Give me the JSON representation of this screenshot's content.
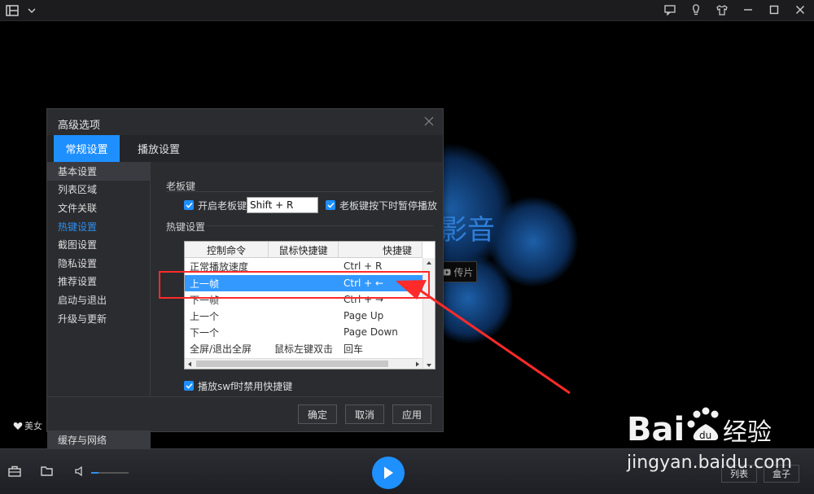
{
  "titlebar": {
    "icons": [
      "playlist-icon",
      "chevron-down-icon",
      "message-icon",
      "bulb-icon",
      "shirt-icon",
      "minimize-icon",
      "maximize-icon",
      "close-icon"
    ]
  },
  "stage": {
    "brand_text": "影音",
    "upload_label": "传片",
    "meinv_label": "美女"
  },
  "dialog": {
    "title": "高级选项",
    "tabs": [
      {
        "label": "常规设置",
        "active": true
      },
      {
        "label": "播放设置",
        "active": false
      }
    ],
    "sidebar": {
      "items": [
        {
          "label": "基本设置"
        },
        {
          "label": "列表区域"
        },
        {
          "label": "文件关联"
        },
        {
          "label": "热键设置"
        },
        {
          "label": "截图设置"
        },
        {
          "label": "隐私设置"
        },
        {
          "label": "推荐设置"
        },
        {
          "label": "启动与退出"
        },
        {
          "label": "升级与更新"
        }
      ],
      "bottom_item": "缓存与网络"
    },
    "boss_key": {
      "section": "老板键",
      "enable_label": "开启老板键",
      "key_value": "Shift + R",
      "pause_label": "老板键按下时暂停播放"
    },
    "hotkeys": {
      "section": "热键设置",
      "columns": [
        "控制命令",
        "鼠标快捷键",
        "快捷键"
      ],
      "rows": [
        {
          "command": "正常播放速度",
          "mouse": "",
          "key": "Ctrl + R"
        },
        {
          "command": "上一帧",
          "mouse": "",
          "key": "Ctrl + ←"
        },
        {
          "command": "下一帧",
          "mouse": "",
          "key": "Ctrl + →"
        },
        {
          "command": "上一个",
          "mouse": "",
          "key": "Page Up"
        },
        {
          "command": "下一个",
          "mouse": "",
          "key": "Page Down"
        },
        {
          "command": "全屏/退出全屏",
          "mouse": "鼠标左键双击",
          "key": "回车"
        }
      ],
      "swf_label": "播放swf时禁用快捷键"
    },
    "buttons": {
      "ok": "确定",
      "cancel": "取消",
      "apply": "应用"
    }
  },
  "bottombar": {
    "volume_level": 0.2,
    "list_label": "列表",
    "box_label": "盒子"
  },
  "watermark": {
    "brand": "Bai",
    "brand_suffix": "经验",
    "url": "jingyan.baidu.com"
  }
}
